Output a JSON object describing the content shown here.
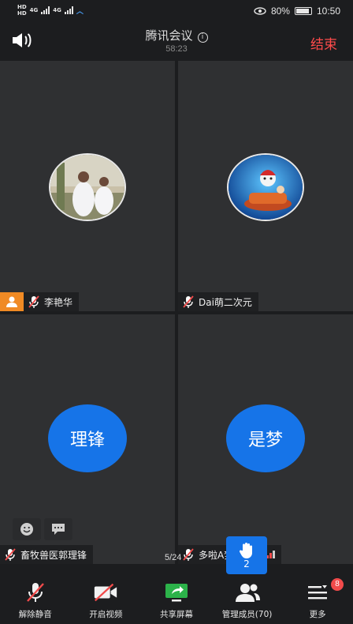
{
  "status_bar": {
    "left_hd1": "HD",
    "left_hd2": "HD",
    "net1": "4G",
    "net2": "4G",
    "battery_pct": "80%",
    "time": "10:50"
  },
  "header": {
    "title": "腾讯会议",
    "info_glyph": "i",
    "timer": "58:23",
    "end_label": "结束"
  },
  "participants": [
    {
      "name": "李艳华",
      "avatar_type": "photo",
      "host": true,
      "muted": true
    },
    {
      "name": "Dai萌二次元",
      "avatar_type": "photo",
      "host": false,
      "muted": true
    },
    {
      "name": "畜牧兽医郭理锋",
      "avatar_text": "理锋",
      "avatar_type": "text",
      "host": false,
      "muted": true
    },
    {
      "name": "多啦A梦不是梦",
      "avatar_text": "是梦",
      "avatar_type": "text",
      "host": false,
      "muted": true,
      "signal": "weak"
    }
  ],
  "page_indicator": "5/24",
  "raise_hand_count": "2",
  "toolbar": {
    "unmute": "解除静音",
    "start_video": "开启视频",
    "share_screen": "共享屏幕",
    "manage_members": "管理成员(70)",
    "more": "更多",
    "more_badge": "8"
  },
  "colors": {
    "accent_blue": "#1674e8",
    "end_red": "#ff4b4b",
    "host_orange": "#f08a24",
    "share_green": "#2cb34a"
  }
}
